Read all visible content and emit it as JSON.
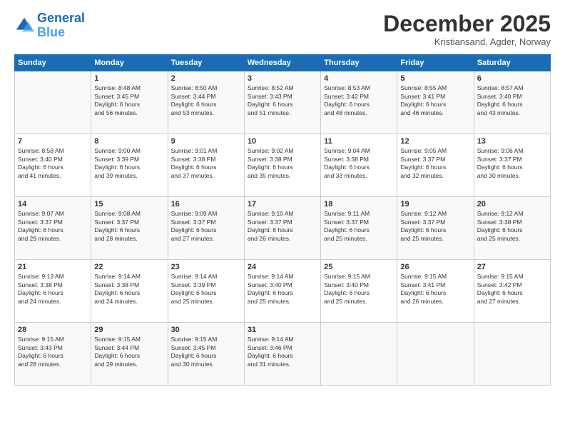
{
  "header": {
    "logo_line1": "General",
    "logo_line2": "Blue",
    "month_title": "December 2025",
    "subtitle": "Kristiansand, Agder, Norway"
  },
  "days_of_week": [
    "Sunday",
    "Monday",
    "Tuesday",
    "Wednesday",
    "Thursday",
    "Friday",
    "Saturday"
  ],
  "weeks": [
    [
      {
        "day": "",
        "sunrise": "",
        "sunset": "",
        "daylight": ""
      },
      {
        "day": "1",
        "sunrise": "Sunrise: 8:48 AM",
        "sunset": "Sunset: 3:45 PM",
        "daylight": "Daylight: 6 hours and 56 minutes."
      },
      {
        "day": "2",
        "sunrise": "Sunrise: 8:50 AM",
        "sunset": "Sunset: 3:44 PM",
        "daylight": "Daylight: 6 hours and 53 minutes."
      },
      {
        "day": "3",
        "sunrise": "Sunrise: 8:52 AM",
        "sunset": "Sunset: 3:43 PM",
        "daylight": "Daylight: 6 hours and 51 minutes."
      },
      {
        "day": "4",
        "sunrise": "Sunrise: 8:53 AM",
        "sunset": "Sunset: 3:42 PM",
        "daylight": "Daylight: 6 hours and 48 minutes."
      },
      {
        "day": "5",
        "sunrise": "Sunrise: 8:55 AM",
        "sunset": "Sunset: 3:41 PM",
        "daylight": "Daylight: 6 hours and 46 minutes."
      },
      {
        "day": "6",
        "sunrise": "Sunrise: 8:57 AM",
        "sunset": "Sunset: 3:40 PM",
        "daylight": "Daylight: 6 hours and 43 minutes."
      }
    ],
    [
      {
        "day": "7",
        "sunrise": "Sunrise: 8:58 AM",
        "sunset": "Sunset: 3:40 PM",
        "daylight": "Daylight: 6 hours and 41 minutes."
      },
      {
        "day": "8",
        "sunrise": "Sunrise: 9:00 AM",
        "sunset": "Sunset: 3:39 PM",
        "daylight": "Daylight: 6 hours and 39 minutes."
      },
      {
        "day": "9",
        "sunrise": "Sunrise: 9:01 AM",
        "sunset": "Sunset: 3:38 PM",
        "daylight": "Daylight: 6 hours and 37 minutes."
      },
      {
        "day": "10",
        "sunrise": "Sunrise: 9:02 AM",
        "sunset": "Sunset: 3:38 PM",
        "daylight": "Daylight: 6 hours and 35 minutes."
      },
      {
        "day": "11",
        "sunrise": "Sunrise: 9:04 AM",
        "sunset": "Sunset: 3:38 PM",
        "daylight": "Daylight: 6 hours and 33 minutes."
      },
      {
        "day": "12",
        "sunrise": "Sunrise: 9:05 AM",
        "sunset": "Sunset: 3:37 PM",
        "daylight": "Daylight: 6 hours and 32 minutes."
      },
      {
        "day": "13",
        "sunrise": "Sunrise: 9:06 AM",
        "sunset": "Sunset: 3:37 PM",
        "daylight": "Daylight: 6 hours and 30 minutes."
      }
    ],
    [
      {
        "day": "14",
        "sunrise": "Sunrise: 9:07 AM",
        "sunset": "Sunset: 3:37 PM",
        "daylight": "Daylight: 6 hours and 29 minutes."
      },
      {
        "day": "15",
        "sunrise": "Sunrise: 9:08 AM",
        "sunset": "Sunset: 3:37 PM",
        "daylight": "Daylight: 6 hours and 28 minutes."
      },
      {
        "day": "16",
        "sunrise": "Sunrise: 9:09 AM",
        "sunset": "Sunset: 3:37 PM",
        "daylight": "Daylight: 6 hours and 27 minutes."
      },
      {
        "day": "17",
        "sunrise": "Sunrise: 9:10 AM",
        "sunset": "Sunset: 3:37 PM",
        "daylight": "Daylight: 6 hours and 26 minutes."
      },
      {
        "day": "18",
        "sunrise": "Sunrise: 9:11 AM",
        "sunset": "Sunset: 3:37 PM",
        "daylight": "Daylight: 6 hours and 25 minutes."
      },
      {
        "day": "19",
        "sunrise": "Sunrise: 9:12 AM",
        "sunset": "Sunset: 3:37 PM",
        "daylight": "Daylight: 6 hours and 25 minutes."
      },
      {
        "day": "20",
        "sunrise": "Sunrise: 9:12 AM",
        "sunset": "Sunset: 3:38 PM",
        "daylight": "Daylight: 6 hours and 25 minutes."
      }
    ],
    [
      {
        "day": "21",
        "sunrise": "Sunrise: 9:13 AM",
        "sunset": "Sunset: 3:38 PM",
        "daylight": "Daylight: 6 hours and 24 minutes."
      },
      {
        "day": "22",
        "sunrise": "Sunrise: 9:14 AM",
        "sunset": "Sunset: 3:38 PM",
        "daylight": "Daylight: 6 hours and 24 minutes."
      },
      {
        "day": "23",
        "sunrise": "Sunrise: 9:14 AM",
        "sunset": "Sunset: 3:39 PM",
        "daylight": "Daylight: 6 hours and 25 minutes."
      },
      {
        "day": "24",
        "sunrise": "Sunrise: 9:14 AM",
        "sunset": "Sunset: 3:40 PM",
        "daylight": "Daylight: 6 hours and 25 minutes."
      },
      {
        "day": "25",
        "sunrise": "Sunrise: 9:15 AM",
        "sunset": "Sunset: 3:40 PM",
        "daylight": "Daylight: 6 hours and 25 minutes."
      },
      {
        "day": "26",
        "sunrise": "Sunrise: 9:15 AM",
        "sunset": "Sunset: 3:41 PM",
        "daylight": "Daylight: 6 hours and 26 minutes."
      },
      {
        "day": "27",
        "sunrise": "Sunrise: 9:15 AM",
        "sunset": "Sunset: 3:42 PM",
        "daylight": "Daylight: 6 hours and 27 minutes."
      }
    ],
    [
      {
        "day": "28",
        "sunrise": "Sunrise: 9:15 AM",
        "sunset": "Sunset: 3:43 PM",
        "daylight": "Daylight: 6 hours and 28 minutes."
      },
      {
        "day": "29",
        "sunrise": "Sunrise: 9:15 AM",
        "sunset": "Sunset: 3:44 PM",
        "daylight": "Daylight: 6 hours and 29 minutes."
      },
      {
        "day": "30",
        "sunrise": "Sunrise: 9:15 AM",
        "sunset": "Sunset: 3:45 PM",
        "daylight": "Daylight: 6 hours and 30 minutes."
      },
      {
        "day": "31",
        "sunrise": "Sunrise: 9:14 AM",
        "sunset": "Sunset: 3:46 PM",
        "daylight": "Daylight: 6 hours and 31 minutes."
      },
      {
        "day": "",
        "sunrise": "",
        "sunset": "",
        "daylight": ""
      },
      {
        "day": "",
        "sunrise": "",
        "sunset": "",
        "daylight": ""
      },
      {
        "day": "",
        "sunrise": "",
        "sunset": "",
        "daylight": ""
      }
    ]
  ]
}
